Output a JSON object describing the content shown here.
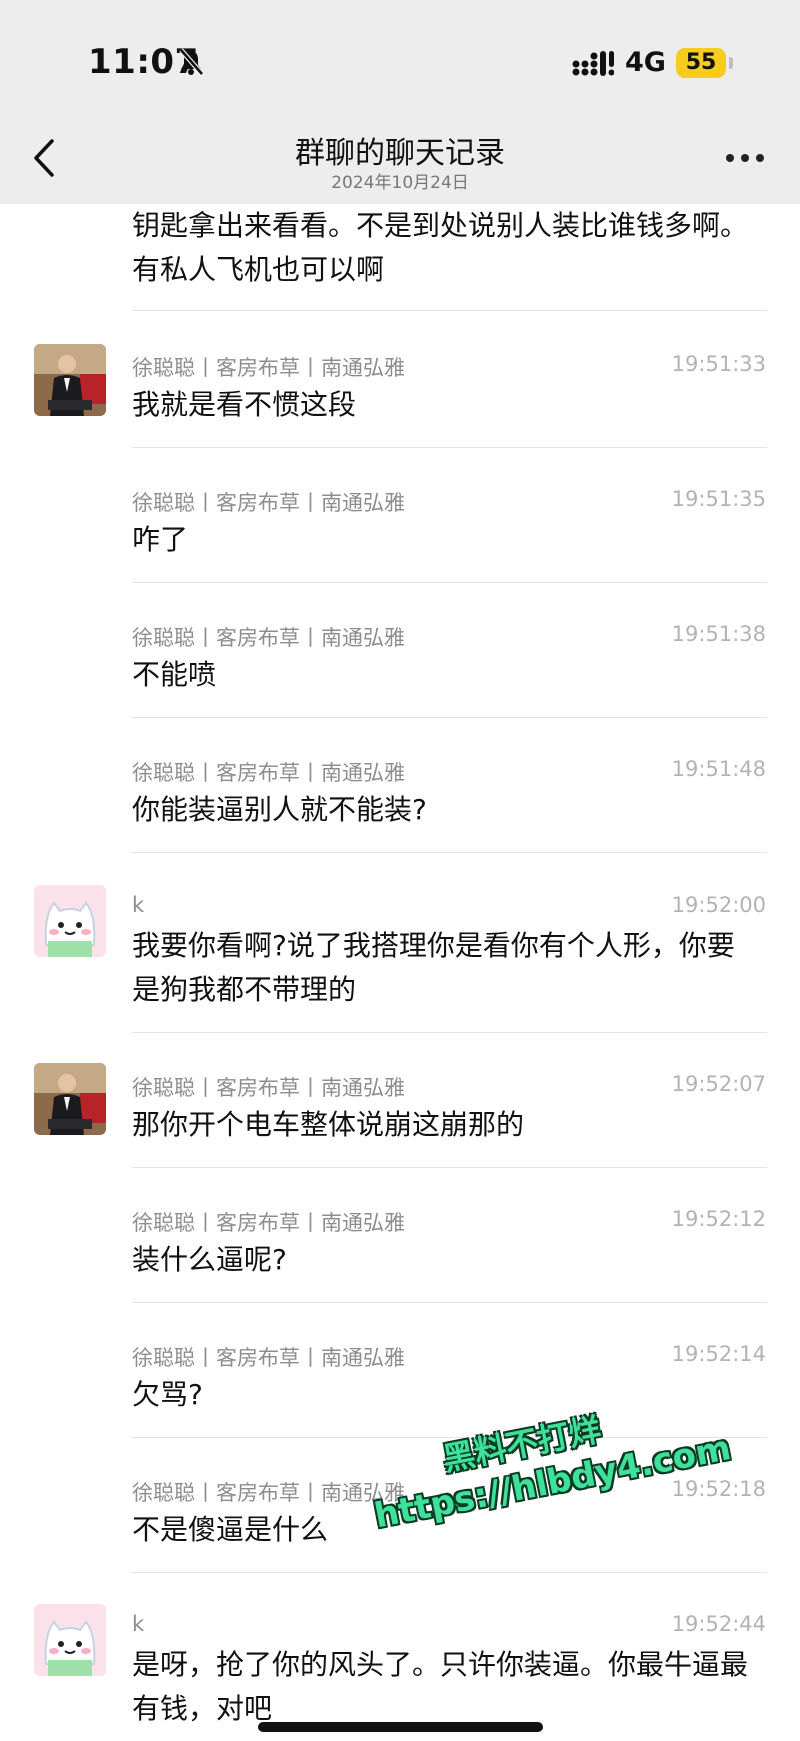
{
  "status_bar": {
    "time": "11:07",
    "network": "4G",
    "battery": "55"
  },
  "nav": {
    "title": "群聊的聊天记录",
    "subtitle": "2024年10月24日"
  },
  "partial_message": "钥匙拿出来看看。不是到处说别人装比谁钱多啊。有私人飞机也可以啊",
  "messages": [
    {
      "sender": "徐聪聪丨客房布草丨南通弘雅",
      "time": "19:51:33",
      "text": "我就是看不惯这段"
    },
    {
      "sender": "徐聪聪丨客房布草丨南通弘雅",
      "time": "19:51:35",
      "text": "咋了"
    },
    {
      "sender": "徐聪聪丨客房布草丨南通弘雅",
      "time": "19:51:38",
      "text": "不能喷"
    },
    {
      "sender": "徐聪聪丨客房布草丨南通弘雅",
      "time": "19:51:48",
      "text": "你能装逼别人就不能装?"
    },
    {
      "sender": "k",
      "time": "19:52:00",
      "text": "我要你看啊?说了我搭理你是看你有个人形，你要是狗我都不带理的"
    },
    {
      "sender": "徐聪聪丨客房布草丨南通弘雅",
      "time": "19:52:07",
      "text": "那你开个电车整体说崩这崩那的"
    },
    {
      "sender": "徐聪聪丨客房布草丨南通弘雅",
      "time": "19:52:12",
      "text": "装什么逼呢?"
    },
    {
      "sender": "徐聪聪丨客房布草丨南通弘雅",
      "time": "19:52:14",
      "text": "欠骂?"
    },
    {
      "sender": "徐聪聪丨客房布草丨南通弘雅",
      "time": "19:52:18",
      "text": "不是傻逼是什么"
    },
    {
      "sender": "k",
      "time": "19:52:44",
      "text": "是呀，抢了你的风头了。只许你装逼。你最牛逼最有钱，对吧"
    }
  ],
  "watermark": {
    "line1": "黑料不打烊",
    "line2": "https://hlbdy4.com"
  },
  "colors": {
    "header_bg": "#ededed",
    "battery": "#f6cc1f",
    "watermark": "#3ee09a"
  }
}
